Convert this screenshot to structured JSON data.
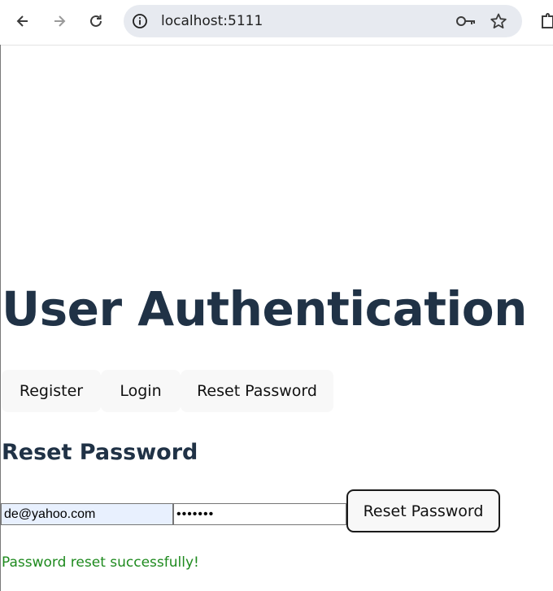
{
  "browser": {
    "url": "localhost:5111"
  },
  "page": {
    "title": "User Authentication",
    "tabs": [
      {
        "label": "Register"
      },
      {
        "label": "Login"
      },
      {
        "label": "Reset Password"
      }
    ],
    "form": {
      "heading": "Reset Password",
      "email_value": "de@yahoo.com",
      "password_value": "•••••••",
      "submit_label": "Reset Password",
      "status_message": "Password reset successfully!"
    }
  },
  "colors": {
    "heading": "#203246",
    "success": "#1e8a1e",
    "autofill": "#e8f0fe"
  }
}
